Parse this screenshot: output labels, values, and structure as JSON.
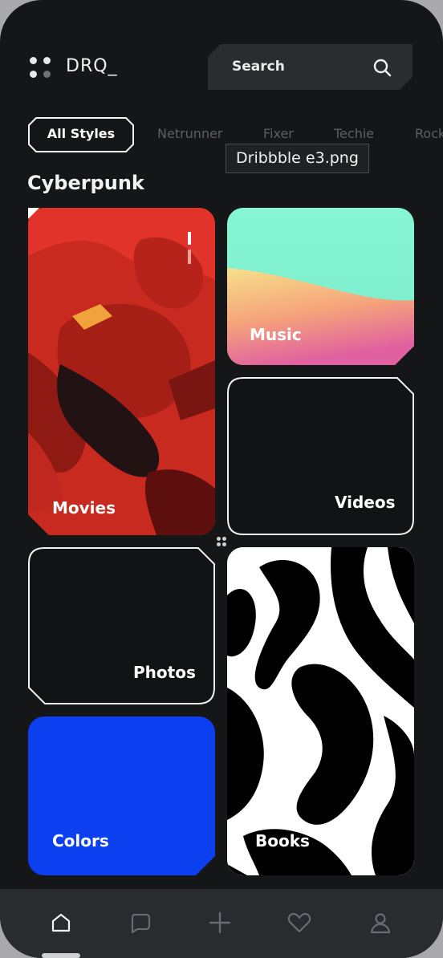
{
  "header": {
    "logo_text": "DRQ_",
    "search_label": "Search"
  },
  "chips": {
    "active": "All Styles",
    "items": [
      "Netrunner",
      "Fixer",
      "Techie",
      "Rock"
    ]
  },
  "tooltip": "Dribbble e3.png",
  "section_title": "Cyberpunk",
  "cards": {
    "movies": "Movies",
    "music": "Music",
    "videos": "Videos",
    "photos": "Photos",
    "colors": "Colors",
    "books": "Books"
  },
  "nav": [
    "home-icon",
    "chat-icon",
    "plus-icon",
    "heart-icon",
    "profile-icon"
  ],
  "colors": {
    "background": "#151618",
    "surface": "#2b2c30",
    "movies": "#e63328",
    "colors_card": "#0b3ff0",
    "music_gradient": [
      "#7ff5cf",
      "#f6d884",
      "#e6598f"
    ]
  }
}
